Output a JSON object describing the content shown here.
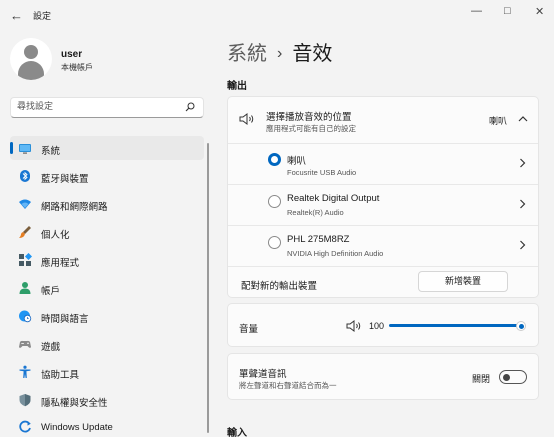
{
  "window": {
    "title": "設定",
    "back_glyph": "←",
    "minimize_glyph": "—",
    "maximize_glyph": "□",
    "close_glyph": "✕"
  },
  "profile": {
    "name": "user",
    "account_type": "本機帳戶"
  },
  "search": {
    "placeholder": "尋找設定"
  },
  "nav": {
    "items": [
      {
        "label": "系統",
        "icon": "monitor-icon"
      },
      {
        "label": "藍牙與裝置",
        "icon": "bluetooth-icon"
      },
      {
        "label": "網路和網際網路",
        "icon": "wifi-icon"
      },
      {
        "label": "個人化",
        "icon": "brush-icon"
      },
      {
        "label": "應用程式",
        "icon": "apps-icon"
      },
      {
        "label": "帳戶",
        "icon": "person-icon"
      },
      {
        "label": "時間與語言",
        "icon": "globe-clock-icon"
      },
      {
        "label": "遊戲",
        "icon": "gamepad-icon"
      },
      {
        "label": "協助工具",
        "icon": "accessibility-icon"
      },
      {
        "label": "隱私權與安全性",
        "icon": "shield-icon"
      },
      {
        "label": "Windows Update",
        "icon": "windows-update-icon"
      }
    ],
    "active_index": 0
  },
  "breadcrumb": {
    "parent": "系統",
    "separator": "›",
    "current": "音效"
  },
  "output": {
    "section_title": "輸出",
    "choose_title": "選擇播放音效的位置",
    "choose_subtitle": "應用程式可能有自己的設定",
    "selected_device": "喇叭",
    "devices": [
      {
        "name": "喇叭",
        "description": "Focusrite USB Audio",
        "selected": true
      },
      {
        "name": "Realtek Digital Output",
        "description": "Realtek(R) Audio",
        "selected": false
      },
      {
        "name": "PHL 275M8RZ",
        "description": "NVIDIA High Definition Audio",
        "selected": false
      }
    ],
    "pair_label": "配對新的輸出裝置",
    "add_device_button": "新增裝置",
    "volume_label": "音量",
    "volume_value": "100",
    "mono_title": "單聲道音訊",
    "mono_subtitle": "將左聲道和右聲道結合而為一",
    "mono_state": "關閉"
  },
  "input": {
    "section_title": "輸入"
  },
  "colors": {
    "accent": "#0067c0",
    "background": "#f3f3f3",
    "card": "#fbfbfb"
  }
}
